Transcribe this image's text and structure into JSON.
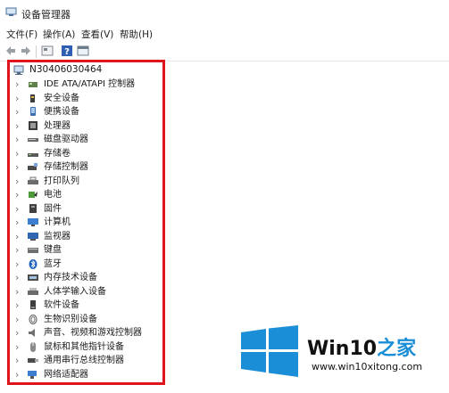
{
  "window": {
    "title": "设备管理器"
  },
  "menu": [
    "文件(F)",
    "操作(A)",
    "查看(V)",
    "帮助(H)"
  ],
  "tree": {
    "root": "N30406030464",
    "items": [
      {
        "label": "IDE ATA/ATAPI 控制器",
        "icon": "ide-controller-icon"
      },
      {
        "label": "安全设备",
        "icon": "security-device-icon"
      },
      {
        "label": "便携设备",
        "icon": "portable-device-icon"
      },
      {
        "label": "处理器",
        "icon": "processor-icon"
      },
      {
        "label": "磁盘驱动器",
        "icon": "disk-drive-icon"
      },
      {
        "label": "存储卷",
        "icon": "storage-volume-icon"
      },
      {
        "label": "存储控制器",
        "icon": "storage-controller-icon"
      },
      {
        "label": "打印队列",
        "icon": "printer-icon"
      },
      {
        "label": "电池",
        "icon": "battery-icon"
      },
      {
        "label": "固件",
        "icon": "firmware-icon"
      },
      {
        "label": "计算机",
        "icon": "computer-icon"
      },
      {
        "label": "监视器",
        "icon": "monitor-icon"
      },
      {
        "label": "键盘",
        "icon": "keyboard-icon"
      },
      {
        "label": "蓝牙",
        "icon": "bluetooth-icon"
      },
      {
        "label": "内存技术设备",
        "icon": "memory-device-icon"
      },
      {
        "label": "人体学输入设备",
        "icon": "hid-icon"
      },
      {
        "label": "软件设备",
        "icon": "software-device-icon"
      },
      {
        "label": "生物识别设备",
        "icon": "biometric-icon"
      },
      {
        "label": "声音、视频和游戏控制器",
        "icon": "sound-icon"
      },
      {
        "label": "鼠标和其他指针设备",
        "icon": "mouse-icon"
      },
      {
        "label": "通用串行总线控制器",
        "icon": "usb-controller-icon"
      },
      {
        "label": "网络适配器",
        "icon": "network-adapter-icon"
      }
    ]
  },
  "watermark": {
    "brand_main": "Win10",
    "brand_accent": "之家",
    "url": "www.win10xitong.com"
  },
  "colors": {
    "highlight": "#e0141c",
    "logo_blue": "#1a8ed6"
  }
}
